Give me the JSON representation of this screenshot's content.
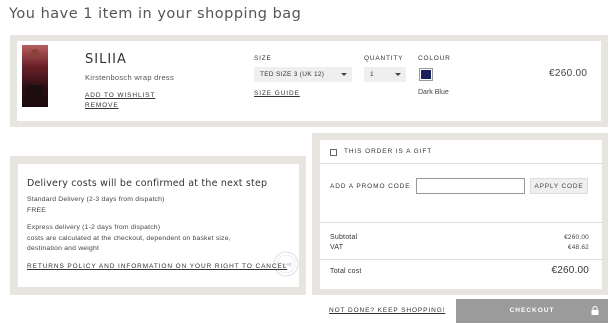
{
  "page": {
    "title": "You have 1 item in your shopping bag"
  },
  "item": {
    "brand": "SILIIA",
    "name": "Kirstenbosch wrap dress",
    "wishlist_label": "ADD TO WISHLIST",
    "remove_label": "REMOVE",
    "size_label": "SIZE",
    "size_value": "TED SIZE 3 (UK 12)",
    "size_guide_label": "SIZE GUIDE",
    "quantity_label": "QUANTITY",
    "quantity_value": "1",
    "colour_label": "COLOUR",
    "colour_name": "Dark Blue",
    "colour_hex": "#1a1f5e",
    "price": "€260.00"
  },
  "delivery": {
    "title": "Delivery costs will be confirmed at the next step",
    "standard": "Standard Delivery (2-3 days from dispatch)",
    "standard_price": "FREE",
    "express": "Express delivery (1-2 days from dispatch)",
    "express_note_1": "costs are calculated at the checkout, dependent on basket size,",
    "express_note_2": "destination and weight",
    "returns_link": "RETURNS POLICY AND INFORMATION ON YOUR RIGHT TO CANCEL"
  },
  "summary": {
    "gift_label": "THIS ORDER IS A GIFT",
    "promo_label": "ADD A PROMO CODE",
    "promo_placeholder": "",
    "apply_label": "APPLY CODE",
    "subtotal_label": "Subtotal",
    "subtotal_value": "€260.00",
    "vat_label": "VAT",
    "vat_value": "€48.62",
    "total_label": "Total cost",
    "total_value": "€260.00"
  },
  "actions": {
    "keep_shopping_label": "NOT DONE? KEEP SHOPPING!",
    "checkout_label": "CHECKOUT"
  },
  "colors": {
    "frame": "#e8e5e0",
    "checkout_bg": "#9b9b9b"
  }
}
